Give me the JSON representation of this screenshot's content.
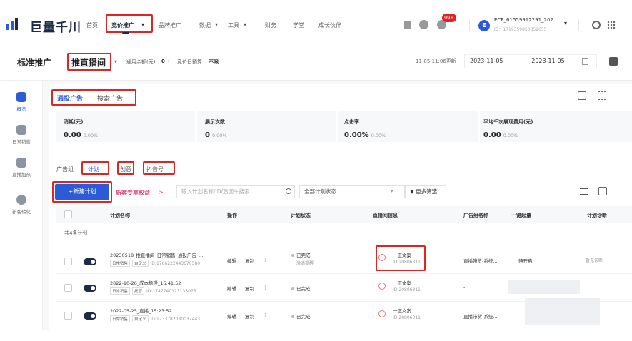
{
  "topnav": {
    "logo_text": "巨量千川",
    "items": [
      "首页",
      "竞价推广",
      "品牌推广",
      "数据",
      "工具",
      "财务",
      "学堂",
      "成长伙伴"
    ],
    "dropdown_indicator": "▾",
    "badge": "99+",
    "account_name": "ECP_61559912291_202...",
    "account_id": "ID：1719359850352655",
    "avatar_letter": "E"
  },
  "subheader": {
    "std_title": "标准推广",
    "live_title": "推直播间",
    "balance_label": "通用余额(元)",
    "balance_value": "0",
    "daily_budget_label": "竞价日预算",
    "daily_budget_value": "不限",
    "update_time": "11-05 11:06更新",
    "date_start": "2023-11-05",
    "date_end": "~ 2023-11-05"
  },
  "sidebar": {
    "items": [
      "概览",
      "日常销售",
      "直播加热",
      "新客转化"
    ]
  },
  "tabs": {
    "general_ad": "通投广告",
    "search_ad": "搜索广告"
  },
  "stats": [
    {
      "label": "消耗(元)",
      "value": "0.00",
      "pct": "0.00%"
    },
    {
      "label": "展示次数",
      "value": "0",
      "pct": "0.00%"
    },
    {
      "label": "点击率",
      "value": "0.00%",
      "pct": "0.00%"
    },
    {
      "label": "平均千次展现费用(元)",
      "value": "0.00",
      "pct": "0.00%"
    }
  ],
  "level_tabs": {
    "group": "广告组",
    "plan": "计划",
    "creative": "创意",
    "douyin": "抖音号"
  },
  "toolbar": {
    "new_plan": "+新建计划",
    "new_customer": "新客专享权益",
    "new_customer_arrow": ">",
    "search_placeholder": "输入计划名称/ID/后回车搜索",
    "status_filter": "全部计划状态",
    "more_filter": "更多筛选"
  },
  "table": {
    "headers": [
      "计划名称",
      "操作",
      "计划状态",
      "直播间信息",
      "广告组名称",
      "一键起量",
      "计划诊断"
    ],
    "count_label": "共4条计划",
    "rows": [
      {
        "name": "20230518_推直播间_日常销售_通投广告_...",
        "tags": [
          "日常销售",
          "自定义"
        ],
        "id": "ID:1766222443670580",
        "ops": [
          "编辑",
          "复制",
          "⋮"
        ],
        "status": "已完成",
        "status_sub": "激活提醒",
        "live_name": "一正文案",
        "live_id": "ID:20806311",
        "group": "直播带货-系统...",
        "boost": "待开启",
        "diag": "暂无诊断"
      },
      {
        "name": "2022-10-26_成本稳投_16:41:52",
        "tags": [
          "日常销售",
          "托管"
        ],
        "id": "ID:1747740123133076",
        "ops": [
          "编辑",
          "复制",
          "⋮"
        ],
        "status": "已完成",
        "status_sub": "",
        "live_name": "一正文案",
        "live_id": "ID:20806311",
        "group": "-",
        "boost": "",
        "diag": ""
      },
      {
        "name": "2022-05-25_直播_15:23:52",
        "tags": [
          "日常销售",
          "自定义"
        ],
        "id": "ID:1733782080037443",
        "ops": [
          "编辑",
          "复制",
          "⋮"
        ],
        "status": "已完成",
        "status_sub": "",
        "live_name": "一正文案",
        "live_id": "ID:20806311",
        "group": "直播带货-系统...",
        "boost": "",
        "diag": ""
      }
    ]
  }
}
